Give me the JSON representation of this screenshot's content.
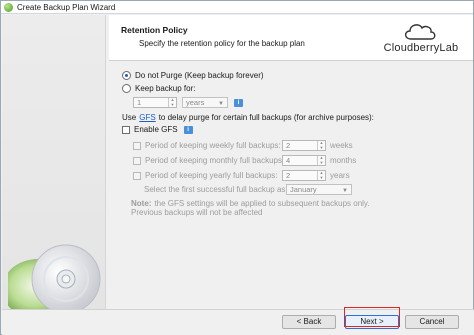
{
  "window": {
    "title": "Create Backup Plan Wizard"
  },
  "header": {
    "title": "Retention Policy",
    "subtitle": "Specify the retention policy for the backup plan",
    "logo_text": "CloudberryLab"
  },
  "retention": {
    "do_not_purge_label": "Do not Purge (Keep backup forever)",
    "do_not_purge_selected": true,
    "keep_backup_label": "Keep backup for:",
    "keep_value": "1",
    "keep_unit": "years",
    "gfs_prefix": "Use",
    "gfs_link": "GFS",
    "gfs_suffix": "to delay purge for certain full backups (for archive purposes):",
    "enable_gfs_label": "Enable GFS"
  },
  "gfs": {
    "weekly_label": "Period of keeping weekly full backups:",
    "weekly_value": "2",
    "weekly_unit": "weeks",
    "monthly_label": "Period of keeping monthly full backups:",
    "monthly_value": "4",
    "monthly_unit": "months",
    "yearly_label": "Period of keeping yearly full backups:",
    "yearly_value": "2",
    "yearly_unit": "years",
    "first_backup_label": "Select the first successful full backup as of:",
    "first_backup_month": "January",
    "note_bold": "Note:",
    "note_line1": "the GFS settings will be applied to subsequent backups only.",
    "note_line2": "Previous backups will not be affected"
  },
  "buttons": {
    "back": "< Back",
    "next": "Next >",
    "cancel": "Cancel"
  },
  "colors": {
    "link": "#1a5fc4",
    "highlight": "#d42a2a",
    "primary_border": "#2f6fd6"
  }
}
